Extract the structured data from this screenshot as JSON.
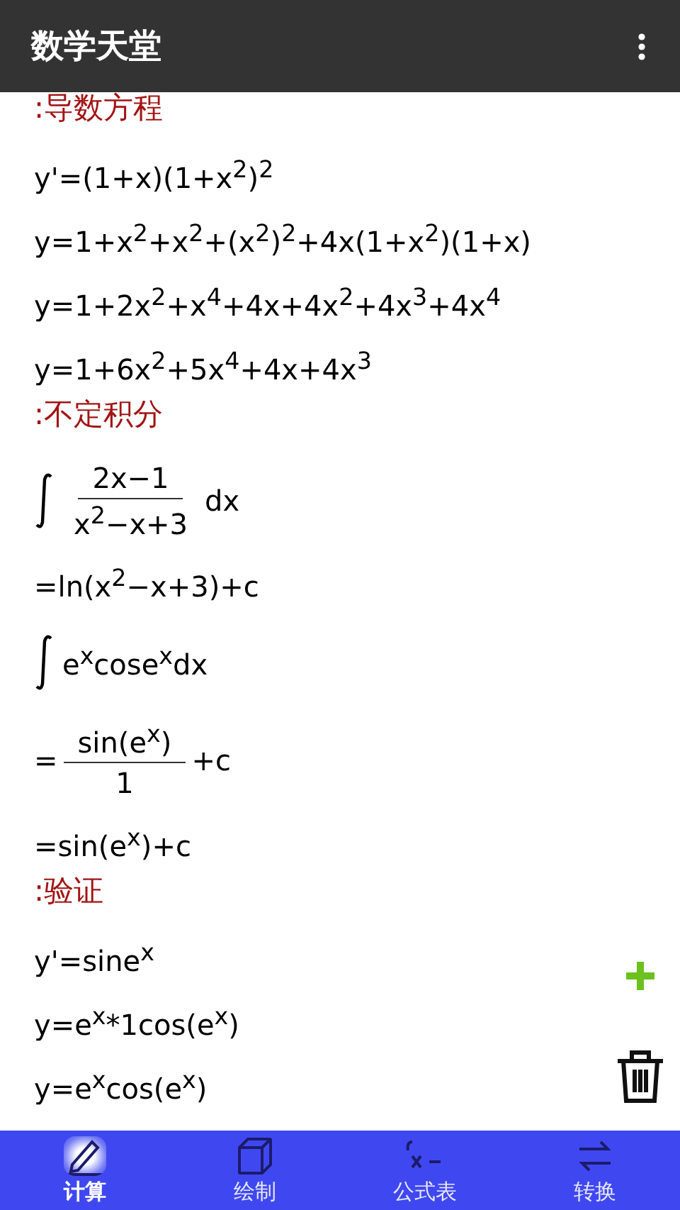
{
  "app_bar": {
    "title": "数学天堂"
  },
  "items": [
    {
      "kind": "heading",
      "text": ":导数方程"
    },
    {
      "kind": "line",
      "text": "y'=(1+x)(1+x$^{2}$)$^{2}$"
    },
    {
      "kind": "line",
      "text": "y=1+x$^{2}$+x$^{2}$+(x$^{2}$)$^{2}$+4x(1+x$^{2}$)(1+x)"
    },
    {
      "kind": "line",
      "text": "y=1+2x$^{2}$+x$^{4}$+4x+4x$^{2}$+4x$^{3}$+4x$^{4}$"
    },
    {
      "kind": "line",
      "text": "y=1+6x$^{2}$+5x$^{4}$+4x+4x$^{3}$"
    },
    {
      "kind": "heading",
      "text": ":不定积分"
    },
    {
      "kind": "integral-fraction",
      "numerator": "2x−1",
      "denominator": "x$^{2}$−x+3",
      "suffix": "dx"
    },
    {
      "kind": "line",
      "text": "=ln(x$^{2}$−x+3)+c"
    },
    {
      "kind": "integral",
      "text": "e$^{x}$cose$^{x}$dx"
    },
    {
      "kind": "fraction",
      "prefix": "=",
      "numerator": "sin(e$^{x}$)",
      "denominator": "1",
      "suffix": "+c"
    },
    {
      "kind": "line",
      "text": "=sin(e$^{x}$)+c"
    },
    {
      "kind": "heading",
      "text": ":验证"
    },
    {
      "kind": "line",
      "text": "y'=sine$^{x}$"
    },
    {
      "kind": "line",
      "text": "y=e$^{x}$*1cos(e$^{x}$)"
    },
    {
      "kind": "line",
      "text": "y=e$^{x}$cos(e$^{x}$)"
    }
  ],
  "bottom_nav": [
    {
      "label": "计算",
      "selected": true
    },
    {
      "label": "绘制",
      "selected": false
    },
    {
      "label": "公式表",
      "selected": false
    },
    {
      "label": "转换",
      "selected": false
    }
  ]
}
